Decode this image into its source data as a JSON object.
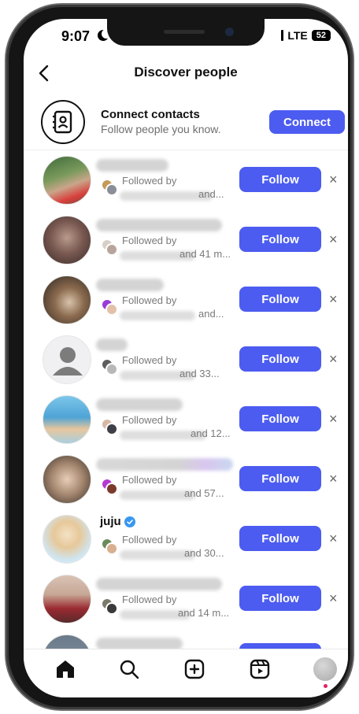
{
  "status": {
    "time": "9:07",
    "network": "LTE",
    "battery": "52"
  },
  "header": {
    "title": "Discover people",
    "back_icon": "chevron-left-icon"
  },
  "connect": {
    "icon": "contact-book-icon",
    "title": "Connect contacts",
    "subtitle": "Follow people you know.",
    "button": "Connect"
  },
  "colors": {
    "accent": "#4c5cf0",
    "notification": "#e0245e"
  },
  "people": [
    {
      "name": "",
      "followed_by": "Followed by",
      "and_text": "and...",
      "button": "Follow",
      "dismiss": "×"
    },
    {
      "name": "",
      "followed_by": "Followed by",
      "and_text": "and 41 m...",
      "button": "Follow",
      "dismiss": "×"
    },
    {
      "name": "",
      "followed_by": "Followed by",
      "and_text": "and...",
      "button": "Follow",
      "dismiss": "×"
    },
    {
      "name": "",
      "followed_by": "Followed by",
      "and_text": "and 33...",
      "button": "Follow",
      "dismiss": "×"
    },
    {
      "name": "",
      "followed_by": "Followed by",
      "and_text": "and 12...",
      "button": "Follow",
      "dismiss": "×"
    },
    {
      "name": "",
      "followed_by": "Followed by",
      "and_text": "and 57...",
      "button": "Follow",
      "dismiss": "×"
    },
    {
      "name": "juju",
      "followed_by": "Followed by",
      "and_text": "and 30...",
      "button": "Follow",
      "dismiss": "×"
    },
    {
      "name": "",
      "followed_by": "Followed by",
      "and_text": "and 14 m...",
      "button": "Follow",
      "dismiss": "×"
    }
  ],
  "tabbar": [
    "home-icon",
    "search-icon",
    "create-plus-icon",
    "reels-icon",
    "profile-avatar"
  ]
}
